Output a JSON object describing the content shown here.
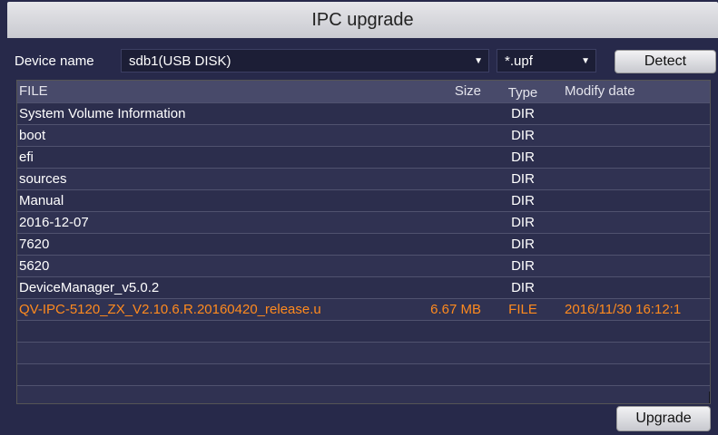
{
  "window": {
    "title": "IPC upgrade"
  },
  "toolbar": {
    "device_label": "Device name",
    "device_value": "sdb1(USB DISK)",
    "filter_value": "*.upf",
    "detect_label": "Detect"
  },
  "table": {
    "columns": {
      "file": "FILE",
      "size": "Size",
      "type": "Type",
      "modify": "Modify date"
    },
    "rows": [
      {
        "name": "System Volume Information",
        "size": "",
        "type": "DIR",
        "date": ""
      },
      {
        "name": "boot",
        "size": "",
        "type": "DIR",
        "date": ""
      },
      {
        "name": "efi",
        "size": "",
        "type": "DIR",
        "date": ""
      },
      {
        "name": "sources",
        "size": "",
        "type": "DIR",
        "date": ""
      },
      {
        "name": "Manual",
        "size": "",
        "type": "DIR",
        "date": ""
      },
      {
        "name": "2016-12-07",
        "size": "",
        "type": "DIR",
        "date": ""
      },
      {
        "name": "7620",
        "size": "",
        "type": "DIR",
        "date": ""
      },
      {
        "name": "5620",
        "size": "",
        "type": "DIR",
        "date": ""
      },
      {
        "name": "DeviceManager_v5.0.2",
        "size": "",
        "type": "DIR",
        "date": ""
      },
      {
        "name": "QV-IPC-5120_ZX_V2.10.6.R.20160420_release.u",
        "size": "6.67 MB",
        "type": "FILE",
        "date": "2016/11/30 16:12:1",
        "selected": true
      },
      {
        "name": "",
        "size": "",
        "type": "",
        "date": ""
      },
      {
        "name": "",
        "size": "",
        "type": "",
        "date": ""
      },
      {
        "name": "",
        "size": "",
        "type": "",
        "date": ""
      },
      {
        "name": "",
        "size": "",
        "type": "",
        "date": ""
      }
    ]
  },
  "footer": {
    "upgrade_label": "Upgrade"
  },
  "colors": {
    "selected_row_text": "#ff8a1e",
    "background": "#27294a",
    "header": "#484a6a"
  }
}
